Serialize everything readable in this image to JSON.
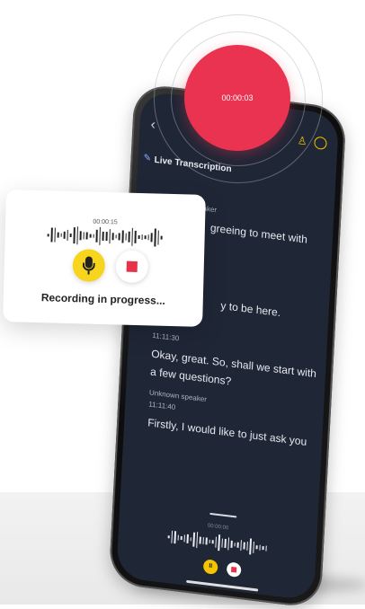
{
  "red_timer": "00:00:03",
  "screen": {
    "title": "Live",
    "section_title": "Live Transcription",
    "transcripts": [
      {
        "speaker": "Unknown speaker",
        "time": "",
        "text": "greeing to meet with"
      },
      {
        "speaker": "",
        "time": "",
        "text": "y to be here."
      },
      {
        "speaker": "",
        "time": "11:11:30",
        "text": "Okay, great. So, shall we start with a few questions?"
      },
      {
        "speaker": "Unknown speaker",
        "time": "11:11:40",
        "text": "Firstly, I would like to just ask you"
      }
    ],
    "bottom_timer": "00:00:00"
  },
  "card": {
    "timer": "00:00:15",
    "status": "Recording in progress..."
  },
  "colors": {
    "accent_yellow": "#f7d51d",
    "record_red": "#ea3350",
    "screen_bg": "#1f2636"
  }
}
